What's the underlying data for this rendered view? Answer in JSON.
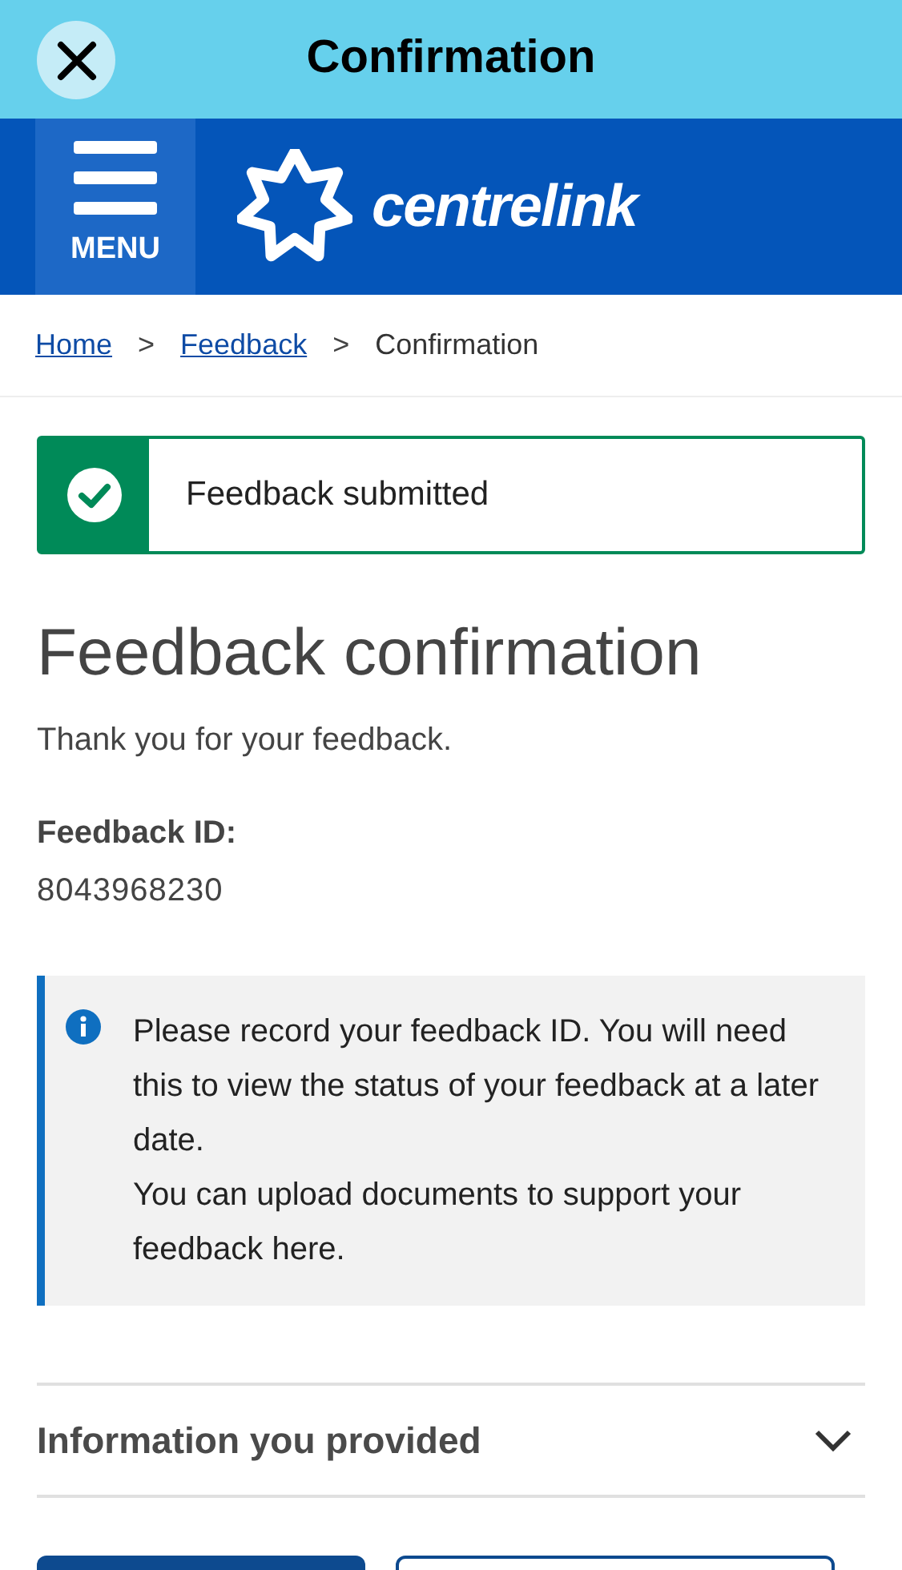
{
  "top_bar": {
    "title": "Confirmation"
  },
  "header": {
    "menu_label": "MENU",
    "logo_text": "centrelink"
  },
  "breadcrumbs": [
    {
      "label": "Home",
      "kind": "link"
    },
    {
      "label": "Feedback",
      "kind": "link"
    },
    {
      "label": "Confirmation",
      "kind": "current"
    }
  ],
  "breadcrumb_separator": ">",
  "alert": {
    "kind": "success",
    "text": "Feedback submitted"
  },
  "heading": "Feedback confirmation",
  "intro": "Thank you for your feedback.",
  "feedback_id": {
    "label": "Feedback ID:",
    "value": "8043968230"
  },
  "info_box": {
    "lines": [
      "Please record your feedback ID. You will need this to view the status of your feedback at a later date.",
      "You can upload documents to support your feedback here."
    ]
  },
  "accordion": {
    "title": "Information you provided",
    "expanded": false
  },
  "buttons": [
    {
      "kind": "primary"
    },
    {
      "kind": "secondary"
    }
  ]
}
